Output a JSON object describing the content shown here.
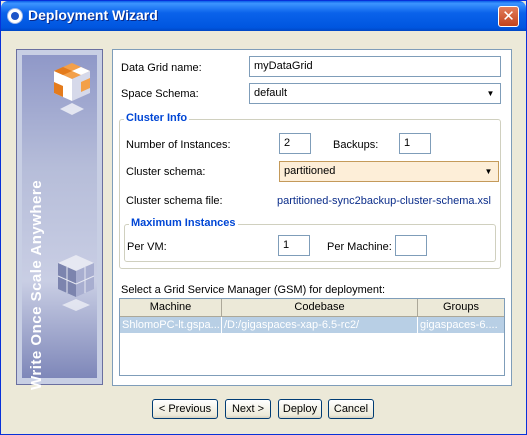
{
  "window": {
    "title": "Deployment Wizard",
    "close_glyph": "✕"
  },
  "side_panel": {
    "tagline": "Write Once Scale Anywhere"
  },
  "form": {
    "grid_name_label": "Data Grid name:",
    "grid_name_value": "myDataGrid",
    "space_schema_label": "Space Schema:",
    "space_schema_value": "default",
    "cluster_info": {
      "title": "Cluster Info",
      "instances_label": "Number of Instances:",
      "instances_value": "2",
      "backups_label": "Backups:",
      "backups_value": "1",
      "cluster_schema_label": "Cluster schema:",
      "cluster_schema_value": "partitioned",
      "cluster_schema_file_label": "Cluster schema file:",
      "cluster_schema_file_value": "partitioned-sync2backup-cluster-schema.xsl",
      "max_instances": {
        "title": "Maximum Instances",
        "per_vm_label": "Per VM:",
        "per_vm_value": "1",
        "per_machine_label": "Per Machine:",
        "per_machine_value": ""
      }
    },
    "gsm_label": "Select a Grid Service Manager (GSM) for deployment:",
    "gsm_table": {
      "headers": [
        "Machine",
        "Codebase",
        "Groups"
      ],
      "rows": [
        [
          "ShlomoPC-lt.gspa...",
          "/D:/gigaspaces-xap-6.5-rc2/",
          "gigaspaces-6...."
        ]
      ]
    }
  },
  "buttons": {
    "previous": "< Previous",
    "next": "Next >",
    "deploy": "Deploy",
    "cancel": "Cancel"
  },
  "icons": {
    "dropdown": "▼"
  },
  "colors": {
    "title_bar": "#0a62ea",
    "section_title": "#0046d5",
    "selected_row": "#b8cfe5"
  }
}
